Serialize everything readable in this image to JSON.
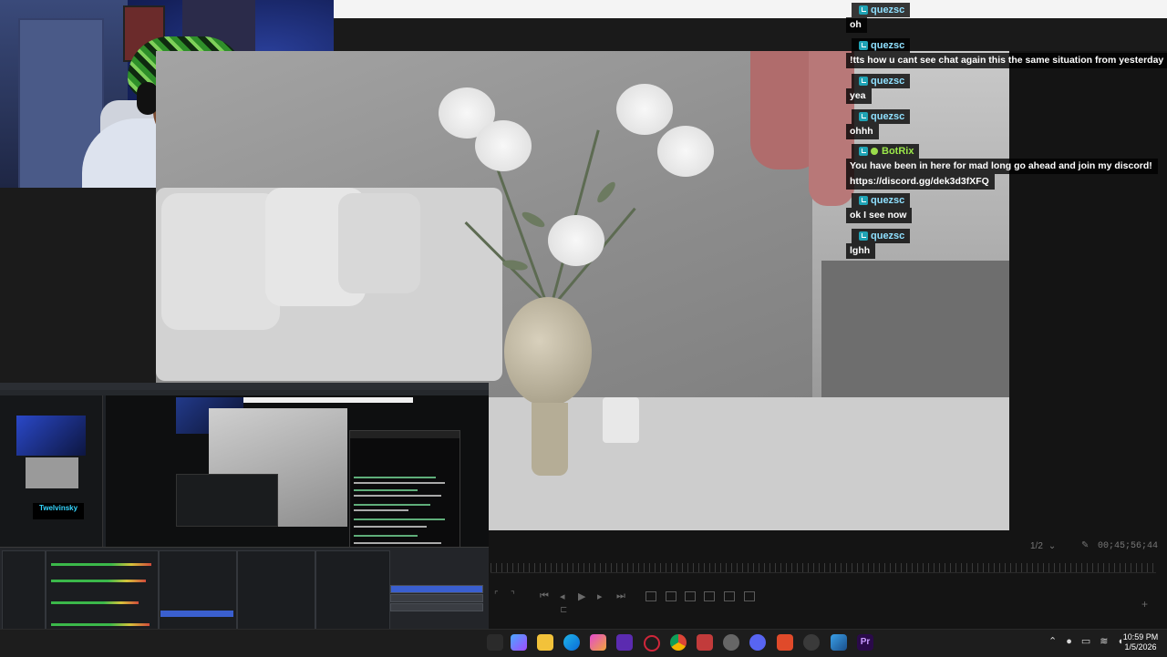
{
  "chat": {
    "messages": [
      {
        "user": "quezsc",
        "text": "oh",
        "bot": false
      },
      {
        "user": "quezsc",
        "text": "!tts how u cant see chat again this the same situation from yesterday",
        "bot": false
      },
      {
        "user": "quezsc",
        "text": "yea",
        "bot": false
      },
      {
        "user": "quezsc",
        "text": "ohhh",
        "bot": false
      },
      {
        "user": "BotRix",
        "text": "You have been in here for mad long go ahead and join my discord!",
        "text2": "https://discord.gg/dek3d3fXFQ",
        "bot": true
      },
      {
        "user": "quezsc",
        "text": "ok I see now",
        "bot": false
      },
      {
        "user": "quezsc",
        "text": "lghh",
        "bot": false
      }
    ]
  },
  "editor": {
    "page_indicator": "1/2",
    "timecode": "00;45;56;44"
  },
  "obs": {
    "brand_text": "Twelvinsky"
  },
  "taskbar": {
    "time": "10:59 PM",
    "date": "1/5/2026"
  },
  "colors": {
    "chat_user": "#8fe0ff",
    "bot_user": "#9be84a",
    "twitch_badge": "#1fa3b5"
  },
  "icons": [
    "twitch-badge-icon",
    "wrench-icon",
    "play-icon",
    "plus-icon",
    "wifi-icon",
    "speaker-icon",
    "mic-icon",
    "chevron-up-icon"
  ]
}
